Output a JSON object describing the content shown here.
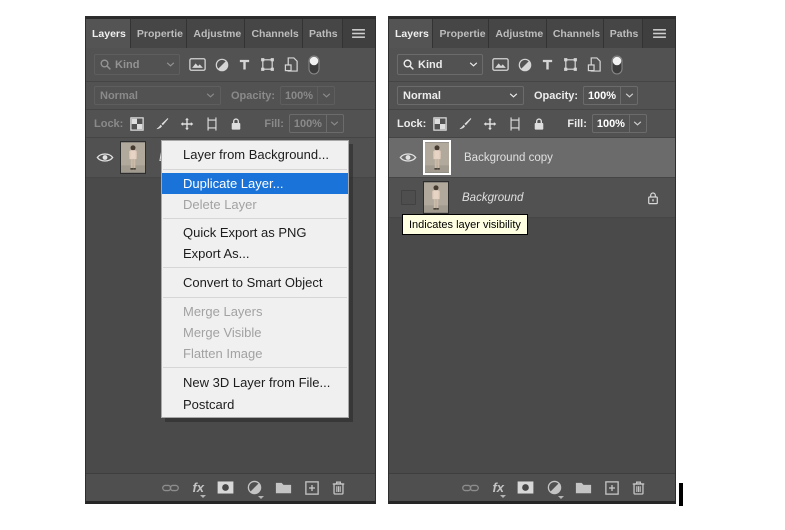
{
  "colors": {
    "accent_blue": "#1a73d8",
    "panel_bg": "#525252",
    "panel_dark": "#4a4a4a",
    "selected_row": "#6b6b6b",
    "tab_bar": "#3f3f3f",
    "tooltip_bg": "#ffffe1"
  },
  "left_panel": {
    "tabs": [
      {
        "label": "Layers"
      },
      {
        "label": "Propertie"
      },
      {
        "label": "Adjustme"
      },
      {
        "label": "Channels"
      },
      {
        "label": "Paths"
      }
    ],
    "search_label": "Kind",
    "blend_mode": "Normal",
    "opacity_label": "Opacity:",
    "opacity_value": "100%",
    "lock_label": "Lock:",
    "fill_label": "Fill:",
    "fill_value": "100%",
    "layers": [
      {
        "name": "Background",
        "italic": true,
        "visible": true
      }
    ]
  },
  "right_panel": {
    "tabs": [
      {
        "label": "Layers"
      },
      {
        "label": "Propertie"
      },
      {
        "label": "Adjustme"
      },
      {
        "label": "Channels"
      },
      {
        "label": "Paths"
      }
    ],
    "search_label": "Kind",
    "blend_mode": "Normal",
    "opacity_label": "Opacity:",
    "opacity_value": "100%",
    "lock_label": "Lock:",
    "fill_label": "Fill:",
    "fill_value": "100%",
    "layers": [
      {
        "name": "Background copy",
        "selected": true,
        "visible": true
      },
      {
        "name": "Background",
        "italic": true,
        "locked": true
      }
    ]
  },
  "context_menu": {
    "items": [
      {
        "label": "Layer from Background...",
        "state": "normal"
      },
      {
        "separator": true
      },
      {
        "label": "Duplicate Layer...",
        "state": "highlighted"
      },
      {
        "label": "Delete Layer",
        "state": "disabled"
      },
      {
        "separator": true
      },
      {
        "label": "Quick Export as PNG",
        "state": "normal"
      },
      {
        "label": "Export As...",
        "state": "normal"
      },
      {
        "separator": true
      },
      {
        "label": "Convert to Smart Object",
        "state": "normal"
      },
      {
        "separator": true
      },
      {
        "label": "Merge Layers",
        "state": "disabled"
      },
      {
        "label": "Merge Visible",
        "state": "disabled"
      },
      {
        "label": "Flatten Image",
        "state": "disabled"
      },
      {
        "separator": true
      },
      {
        "label": "New 3D Layer from File...",
        "state": "normal"
      },
      {
        "label": "Postcard",
        "state": "normal"
      }
    ]
  },
  "bottom_bar": {
    "fx_label": "fx"
  },
  "tooltip": {
    "text": "Indicates layer visibility"
  },
  "icons": {
    "panel_menu": "hamburger",
    "filter_row": [
      "search",
      "chevron-down",
      "pixel-layer-filter",
      "adjustment-layer-filter",
      "type-layer-filter",
      "shape-layer-filter",
      "smart-object-filter",
      "filter-toggle"
    ],
    "lock_row": [
      "lock-transparency",
      "lock-paint",
      "lock-move",
      "lock-artboard",
      "lock-all"
    ],
    "layer_row": [
      "eye-visibility",
      "padlock"
    ],
    "bottom_bar": [
      "link-layers",
      "fx-effects",
      "layer-mask",
      "adjustment-layer",
      "new-group-folder",
      "new-layer-plus",
      "delete-trash"
    ]
  }
}
